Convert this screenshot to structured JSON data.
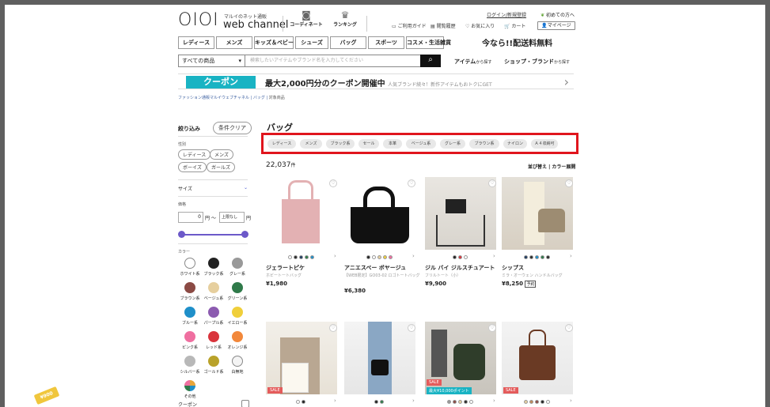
{
  "header": {
    "logo_mark": "OIOI",
    "logo_small": "マルイのネット通販",
    "logo_main": "web channel",
    "coordinate": "コーディネート",
    "ranking": "ランキング",
    "login_link": "ログイン/新規登録",
    "first_time": "初めての方へ",
    "guide": "ご利用ガイド",
    "history": "閲覧履歴",
    "favorite": "お気に入り",
    "cart": "カート",
    "mypage": "マイページ",
    "promo": "今なら!!配送料無料"
  },
  "categories": [
    "レディース",
    "メンズ",
    "キッズ＆ベビー",
    "シューズ",
    "バッグ",
    "スポーツ",
    "コスメ・生活雑貨"
  ],
  "search": {
    "scope": "すべての商品",
    "placeholder": "検索したいアイテムやブランド名を入力してください",
    "item_search": "アイテム",
    "item_search_suffix": "から探す",
    "shop_search": "ショップ・ブランド",
    "shop_search_suffix": "から探す"
  },
  "coupon_banner": {
    "button": "クーポン",
    "text": "最大2,000円分のクーポン開催中",
    "sub": "人気ブランド続々！新作アイテムもおトクにGET"
  },
  "breadcrumb": {
    "links": "ファッション通販マルイウェブチャネル | バッグ |",
    "current": "対象商品"
  },
  "sidebar": {
    "title": "絞り込み",
    "clear": "条件クリア",
    "gender_label": "性別",
    "genders": [
      "レディース",
      "メンズ",
      "ボーイズ",
      "ガールズ"
    ],
    "size_label": "サイズ",
    "price_label": "価格",
    "price_min": "0",
    "price_unit": "円",
    "price_tilde": "〜",
    "price_max": "上限なし",
    "color_label": "カラー",
    "colors": [
      {
        "name": "ホワイト系",
        "hex": "#ffffff"
      },
      {
        "name": "ブラック系",
        "hex": "#222222"
      },
      {
        "name": "グレー系",
        "hex": "#999999"
      },
      {
        "name": "ブラウン系",
        "hex": "#8b4a44"
      },
      {
        "name": "ベージュ系",
        "hex": "#e6cf9e"
      },
      {
        "name": "グリーン系",
        "hex": "#2f7a4a"
      },
      {
        "name": "ブルー系",
        "hex": "#1f8fc9"
      },
      {
        "name": "パープル系",
        "hex": "#8c5bb0"
      },
      {
        "name": "イエロー系",
        "hex": "#f0cf3a"
      },
      {
        "name": "ピンク系",
        "hex": "#ef6fa0"
      },
      {
        "name": "レッド系",
        "hex": "#d9343c"
      },
      {
        "name": "オレンジ系",
        "hex": "#f2883b"
      },
      {
        "name": "シルバー系",
        "hex": "#b8b8b8"
      },
      {
        "name": "ゴールド系",
        "hex": "#b9a22a"
      },
      {
        "name": "白無地",
        "hex": "#f4f4f4"
      },
      {
        "name": "総柄",
        "hex": "#f4f4f4"
      },
      {
        "name": "その他",
        "hex": "#e8a53a"
      }
    ],
    "coupon_label": "クーポン"
  },
  "main": {
    "title": "バッグ",
    "tags": [
      "レディース",
      "メンズ",
      "ブラック系",
      "セール",
      "本革",
      "ベージュ系",
      "グレー系",
      "ブラウン系",
      "ナイロン",
      "Ａ４収納可"
    ],
    "count": "22,037",
    "count_unit": "件",
    "sort": "並び替え",
    "color_view": "カラー展開"
  },
  "products": [
    {
      "name": "ジェラートピケ",
      "desc": "ホビートートバッグ",
      "price": "¥1,980",
      "badge": "",
      "dots": [
        "#ffffff",
        "#2a2a2a",
        "#1f3a5f",
        "#2f7a4a",
        "#1f8fc9"
      ]
    },
    {
      "name": "アニエスベー ボヤージュ",
      "desc": "【WEB限定】GO03-02 ロゴトートバッグ",
      "price": "¥6,380",
      "badge": "",
      "dots": [
        "#222222",
        "#ffffff",
        "#e6cf9e",
        "#f0cf3a",
        "#ef6fa0"
      ]
    },
    {
      "name": "ジル バイ ジルスチュアート",
      "desc": "フリルトート（小）",
      "price": "¥9,900",
      "badge": "",
      "dots": [
        "#222222",
        "#d9343c",
        "#ffffff"
      ]
    },
    {
      "name": "シップス",
      "desc": "ミラ・オーウェン ハンドルバッグ",
      "price": "¥8,250",
      "badge": "予約",
      "dots": [
        "#1f3a5f",
        "#2a2a2a",
        "#1f8fc9",
        "#2f7a4a",
        "#2a2a2a"
      ]
    },
    {
      "sale": "SALE",
      "badge": "",
      "dots": [
        "#ffffff",
        "#222222"
      ]
    },
    {
      "badge": "",
      "dots": [
        "#222222",
        "#2f7a4a"
      ]
    },
    {
      "sale": "SALE",
      "point": "最大¥10,000ポイント",
      "badge": "",
      "dots": [
        "#999999",
        "#8b4a44",
        "#e6cf9e",
        "#2a2a2a",
        "#ffffff"
      ]
    },
    {
      "sale": "SALE",
      "badge": "",
      "dots": [
        "#e6cf9e",
        "#c28b5a",
        "#8b4a44",
        "#222222",
        "#ffffff"
      ]
    }
  ],
  "floating_tag": "¥900"
}
